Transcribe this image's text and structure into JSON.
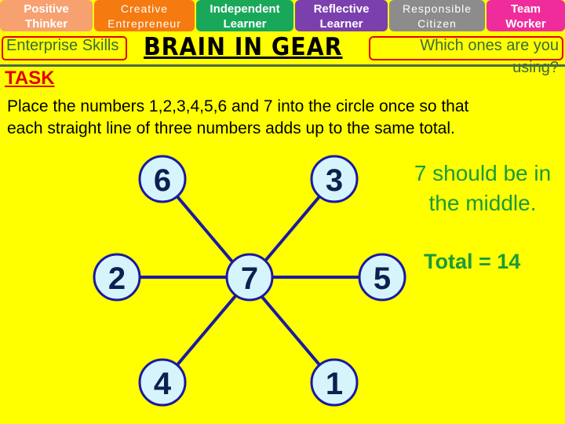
{
  "skills": [
    {
      "line1": "Positive",
      "line2": "Thinker",
      "color": "#f7a070"
    },
    {
      "line1": "Creative",
      "line2": "Entrepreneur",
      "color": "#f57a10"
    },
    {
      "line1": "Independent",
      "line2": "Learner",
      "color": "#19a85a"
    },
    {
      "line1": "Reflective",
      "line2": "Learner",
      "color": "#7b3fae"
    },
    {
      "line1": "Responsible",
      "line2": "Citizen",
      "color": "#8c8c8c"
    },
    {
      "line1": "Team",
      "line2": "Worker",
      "color": "#f02c9c"
    }
  ],
  "header": {
    "enterprise_label": "Enterprise Skills",
    "title": "BRAIN IN GEAR",
    "question": "Which ones are you using?"
  },
  "task": {
    "label": "TASK",
    "instruction_line1": "Place the numbers 1,2,3,4,5,6 and 7 into the circle once so that",
    "instruction_line2": "each straight line of three numbers adds up to the same total."
  },
  "diagram": {
    "center": "7",
    "nodes": {
      "top_left": "6",
      "top_right": "3",
      "left": "2",
      "right": "5",
      "bottom_left": "4",
      "bottom_right": "1"
    },
    "node_fill": "#d6f4fb",
    "node_stroke": "#1a1aa0",
    "line_color": "#1a1aa0"
  },
  "answer": {
    "hint_line1": "7 should be in",
    "hint_line2": "the middle.",
    "total": "Total = 14"
  }
}
